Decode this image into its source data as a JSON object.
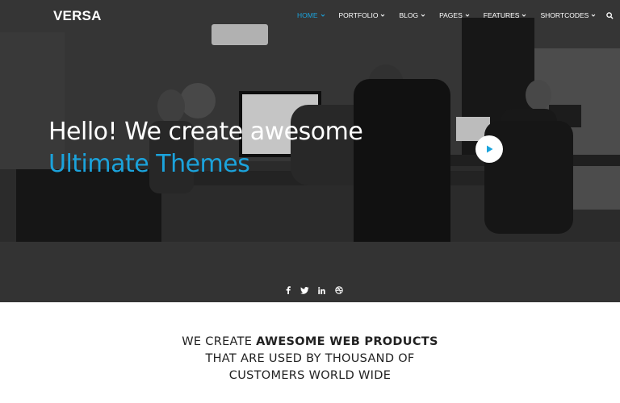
{
  "brand": {
    "logo_text": "VERSA"
  },
  "nav": {
    "items": [
      {
        "label": "HOME",
        "active": true
      },
      {
        "label": "PORTFOLIO"
      },
      {
        "label": "BLOG"
      },
      {
        "label": "PAGES"
      },
      {
        "label": "FEATURES"
      },
      {
        "label": "SHORTCODES"
      }
    ],
    "search_icon": "search-icon"
  },
  "hero": {
    "line1": "Hello! We create awesome",
    "line2": "Ultimate Themes",
    "play_icon": "play-icon",
    "social_icons": [
      "facebook-icon",
      "twitter-icon",
      "linkedin-icon",
      "dribbble-icon"
    ]
  },
  "tagline": {
    "part1": "WE CREATE ",
    "part1_bold": "AWESOME WEB PRODUCTS",
    "line2": "THAT ARE USED BY THOUSAND OF",
    "line3": "CUSTOMERS WORLD WIDE"
  },
  "colors": {
    "accent": "#1ba3dc",
    "hero_overlay": "#2e2e2e",
    "text_dark": "#222222"
  }
}
